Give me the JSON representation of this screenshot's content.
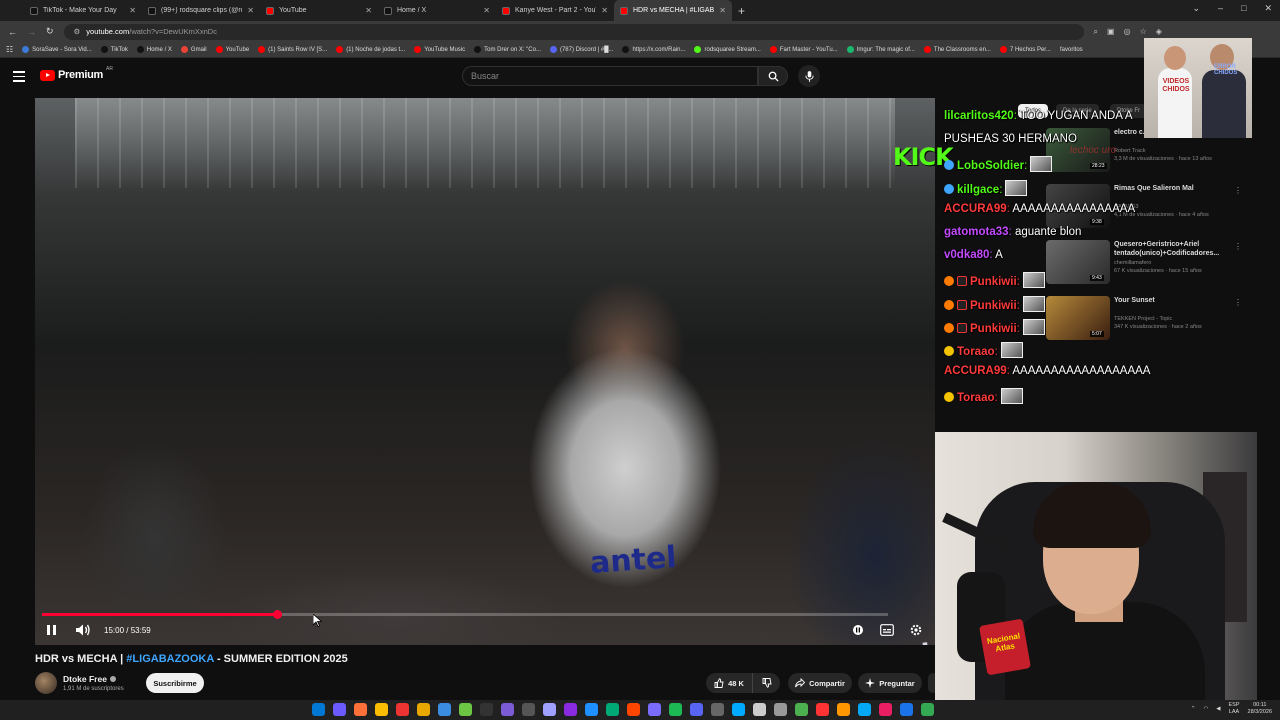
{
  "browser": {
    "tabs": [
      {
        "label": "TikTok - Make Your Day",
        "color": "#111111",
        "active": false
      },
      {
        "label": "(99+) rodsquare clips (@rodsq...",
        "color": "#111111",
        "active": false
      },
      {
        "label": "YouTube",
        "color": "#ff0000",
        "active": false
      },
      {
        "label": "Home / X",
        "color": "#111111",
        "active": false
      },
      {
        "label": "Kanye West - Part 2 - YouTube",
        "color": "#ff0000",
        "active": false
      },
      {
        "label": "HDR vs MECHA | #LIGABA...",
        "color": "#ff0000",
        "active": true
      }
    ],
    "new_tab": "+",
    "url_domain": "youtube.com",
    "url_path": "/watch?v=DewUKmXxnDc",
    "bookmarks": [
      {
        "label": "SoraSave - Sora Vid...",
        "color": "#3d7bd6"
      },
      {
        "label": "TikTok",
        "color": "#111111"
      },
      {
        "label": "Home / X",
        "color": "#111111"
      },
      {
        "label": "Gmail",
        "color": "#ea4335"
      },
      {
        "label": "YouTube",
        "color": "#ff0000"
      },
      {
        "label": "(1) Saints Row IV [S...",
        "color": "#ff0000"
      },
      {
        "label": "(1) Noche de jodas t...",
        "color": "#ff0000"
      },
      {
        "label": "YouTube Music",
        "color": "#ff0000"
      },
      {
        "label": "Tom Drer on X: \"Co...",
        "color": "#111111"
      },
      {
        "label": "(787) Discord | #█...",
        "color": "#5865f2"
      },
      {
        "label": "https://x.com/Rain...",
        "color": "#111111"
      },
      {
        "label": "rodsquaree Stream...",
        "color": "#53fc18"
      },
      {
        "label": "Fart Master - YouTu...",
        "color": "#ff0000"
      },
      {
        "label": "Imgur: The magic of...",
        "color": "#1bb76e"
      },
      {
        "label": "The Classrooms en...",
        "color": "#ff0000"
      },
      {
        "label": "7 Hechos Per...",
        "color": "#ff0000"
      }
    ],
    "bookmarks_end": "favoritos"
  },
  "youtube": {
    "logo": "Premium",
    "region": "AR",
    "search_placeholder": "Buscar"
  },
  "player": {
    "current_time": "15:00",
    "duration": "53:59",
    "time_separator": " / ",
    "progress_fraction": 0.278
  },
  "video": {
    "title_prefix": "HDR vs MECHA | ",
    "hashtag": "#LIGABAZOOKA",
    "title_suffix": " - SUMMER EDITION 2025",
    "shirt_text": "antel",
    "channel": "Dtoke Free",
    "subscribers": "1,91 M de suscriptores",
    "subscribe": "Suscribirme",
    "likes": "48 K",
    "share": "Compartir",
    "ask": "Preguntar"
  },
  "sidebar": {
    "chips": [
      "Todos",
      "De la serie",
      "Dtoke Fr"
    ],
    "recommendations": [
      {
        "title": "electro c... TBoGT)",
        "channel": "Robert Track",
        "views": "3,3 M de visualizaciones · hace 13 años",
        "duration": "28:23"
      },
      {
        "title": "Rimas Que Salieron Mal",
        "channel": "NATANS3",
        "views": "4,1 M de visualizaciones · hace 4 años",
        "duration": "9:38"
      },
      {
        "title": "Quesero+Geristrico+Ariel tentado(unico)+Codificadores...",
        "channel": "chemillamafero",
        "views": "67 K visualizaciones · hace 15 años",
        "duration": "9:43"
      },
      {
        "title": "Your Sunset",
        "channel": "TEKKEN Project - Topic",
        "views": "347 K visualizaciones · hace 2 años",
        "duration": "5:07"
      }
    ]
  },
  "stream_overlay": {
    "kick_logo": "KICK",
    "overlay_label": "lechoc uro",
    "webcam_top_label": "VIDEOS CHIDOS",
    "webcam_top_label2": "ERROR CHIDOS",
    "sticker": "Nacional Atlas"
  },
  "chat": [
    {
      "user": "lilcarlitos420",
      "text": " TOO YUGAN ANDA A",
      "color": "#53fc18",
      "badges": []
    },
    {
      "user": "",
      "text": "PUSHEAS 30 HERMANO",
      "color": "#ffffff",
      "badges": []
    },
    {
      "user": "LoboSoldier",
      "text": "",
      "color": "#53fc18",
      "badges": [
        "blue"
      ],
      "emote": true
    },
    {
      "user": "killgace",
      "text": "",
      "color": "#53fc18",
      "badges": [
        "blue"
      ],
      "emote": true
    },
    {
      "user": "ACCURA99",
      "text": " AAAAAAAAAAAAAAAA",
      "color": "#ff3b3b",
      "badges": []
    },
    {
      "user": "gatomota33",
      "text": " aguante blon",
      "color": "#c44bff",
      "badges": []
    },
    {
      "user": "v0dka80",
      "text": " A",
      "color": "#c44bff",
      "badges": []
    },
    {
      "user": "Punkiwii",
      "text": "",
      "color": "#ff3b3b",
      "badges": [
        "orange",
        "sq"
      ],
      "emote": true
    },
    {
      "user": "Punkiwii",
      "text": "",
      "color": "#ff3b3b",
      "badges": [
        "orange",
        "sq"
      ],
      "emote": true
    },
    {
      "user": "Punkiwii",
      "text": "",
      "color": "#ff3b3b",
      "badges": [
        "orange",
        "sq"
      ],
      "emote": true
    },
    {
      "user": "Toraao",
      "text": "",
      "color": "#ff3b3b",
      "badges": [
        "yellow"
      ],
      "emote": true
    },
    {
      "user": "ACCURA99",
      "text": " AAAAAAAAAAAAAAAAAA",
      "color": "#ff3b3b",
      "badges": []
    },
    {
      "user": "Toraao",
      "text": "",
      "color": "#ff3b3b",
      "badges": [
        "yellow"
      ],
      "emote": true
    }
  ],
  "taskbar": {
    "lang_top": "ESP",
    "lang_bottom": "LAA",
    "time": "00:11",
    "date": "28/3/2026"
  }
}
